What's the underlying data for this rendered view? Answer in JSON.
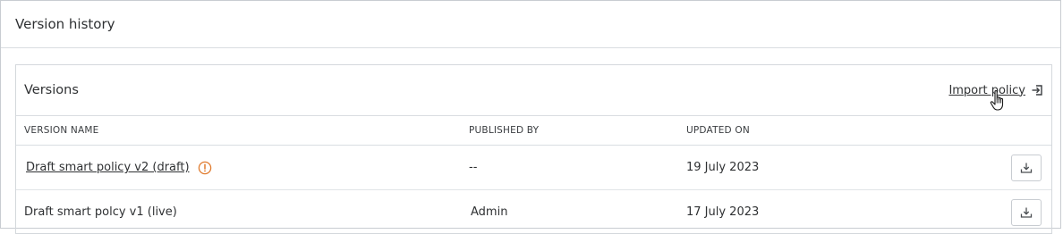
{
  "page": {
    "title": "Version history"
  },
  "versions_panel": {
    "title": "Versions",
    "import_label": "Import policy",
    "columns": [
      "VERSION NAME",
      "PUBLISHED BY",
      "UPDATED ON"
    ],
    "rows": [
      {
        "name": "Draft smart policy v2 (draft)",
        "published_by": "--",
        "updated_on": "19 July 2023"
      },
      {
        "name": "Draft smart polcy v1 (live)",
        "published_by": "Admin",
        "updated_on": "17 July 2023"
      }
    ]
  },
  "icons": {
    "import": "import-icon",
    "warning": "warning-circle-icon",
    "download": "download-icon",
    "cursor": "hand-pointer-icon"
  },
  "colors": {
    "warning": "#e07b2e",
    "border": "#d4d8dc",
    "text": "#2f3133"
  }
}
